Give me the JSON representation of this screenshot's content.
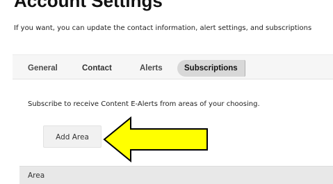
{
  "page": {
    "heading": "Account Settings",
    "intro": "If you want, you can update the contact information, alert settings, and subscriptions"
  },
  "tabs": [
    {
      "label": "General",
      "active": false
    },
    {
      "label": "Contact",
      "active": false
    },
    {
      "label": "Alerts",
      "active": false
    },
    {
      "label": "Subscriptions",
      "active": true
    }
  ],
  "subscriptions": {
    "description": "Subscribe to receive Content E-Alerts from areas of your choosing.",
    "add_button_label": "Add Area",
    "table": {
      "columns": [
        "Area"
      ]
    }
  },
  "annotation": {
    "arrow_color": "#ffff00",
    "arrow_outline": "#000000",
    "arrow_direction": "left"
  }
}
